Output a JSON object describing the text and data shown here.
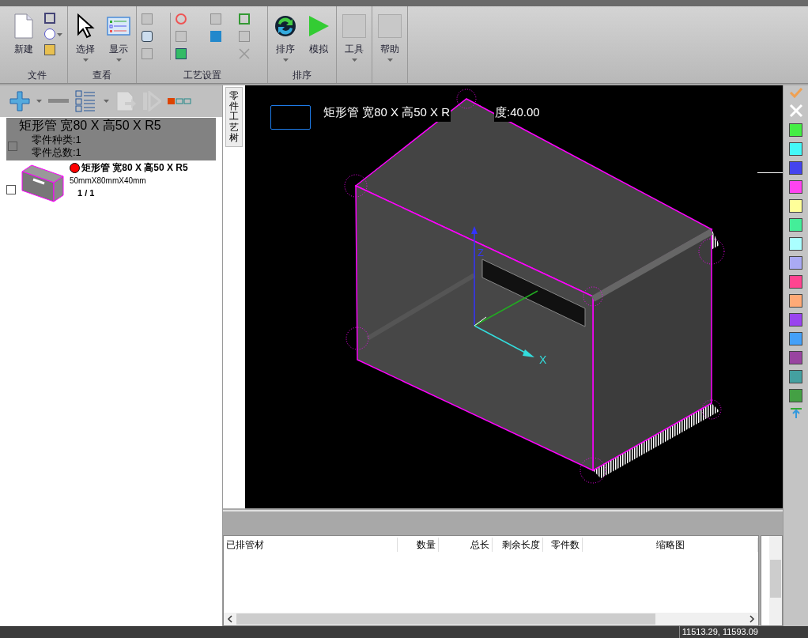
{
  "ribbon": {
    "groups": [
      {
        "label": "文件",
        "buttons": [
          {
            "label": "新建",
            "kind": "new",
            "menu": false
          }
        ]
      },
      {
        "label": "查看",
        "buttons": [
          {
            "label": "选择",
            "kind": "select",
            "menu": true
          },
          {
            "label": "显示",
            "kind": "display",
            "menu": true
          }
        ]
      },
      {
        "label": "工艺设置"
      },
      {
        "label": "排序",
        "buttons": [
          {
            "label": "排序",
            "kind": "sort",
            "menu": true
          },
          {
            "label": "模拟",
            "kind": "simulate",
            "menu": false
          }
        ]
      },
      {
        "buttons": [
          {
            "label": "工具",
            "kind": "blank",
            "menu": true
          }
        ]
      },
      {
        "buttons": [
          {
            "label": "帮助",
            "kind": "blank",
            "menu": true
          }
        ]
      }
    ]
  },
  "part_tree": {
    "group": {
      "title": "矩形管 宽80 X 高50 X R5",
      "checked": false,
      "lines": [
        "零件种类:1",
        "零件总数:1"
      ]
    },
    "parts": [
      {
        "name": "矩形管 宽80 X 高50 X R5",
        "size": "50mmX80mmX40mm",
        "count": "1 / 1",
        "checked": false,
        "color": "#ff0000"
      }
    ]
  },
  "side_tab": {
    "label": "零件工艺树"
  },
  "viewport": {
    "caption_start": "矩形管 宽80 X 高50 X R",
    "caption_end": "度:40.00",
    "axis_z": "Z",
    "axis_x": "X"
  },
  "table": {
    "columns": [
      {
        "label": "已排管材"
      },
      {
        "label": "数量"
      },
      {
        "label": "总长"
      },
      {
        "label": "剩余长度"
      },
      {
        "label": "零件数"
      },
      {
        "label": "缩略图"
      }
    ]
  },
  "palette": [
    {
      "color": "#44ee44"
    },
    {
      "color": "#44f8f8"
    },
    {
      "color": "#4444ee"
    },
    {
      "color": "#ff44f0"
    },
    {
      "color": "#ffff99"
    },
    {
      "color": "#44ee99"
    },
    {
      "color": "#aaffff"
    },
    {
      "color": "#aaaaf4"
    },
    {
      "color": "#ff4490"
    },
    {
      "color": "#ffaa77"
    },
    {
      "color": "#9944ee"
    },
    {
      "color": "#44a0f8"
    },
    {
      "color": "#9944a0"
    },
    {
      "color": "#44a0a0"
    },
    {
      "color": "#44a044"
    }
  ],
  "status_bar": {
    "coords": "11513.29, 11593.09"
  }
}
